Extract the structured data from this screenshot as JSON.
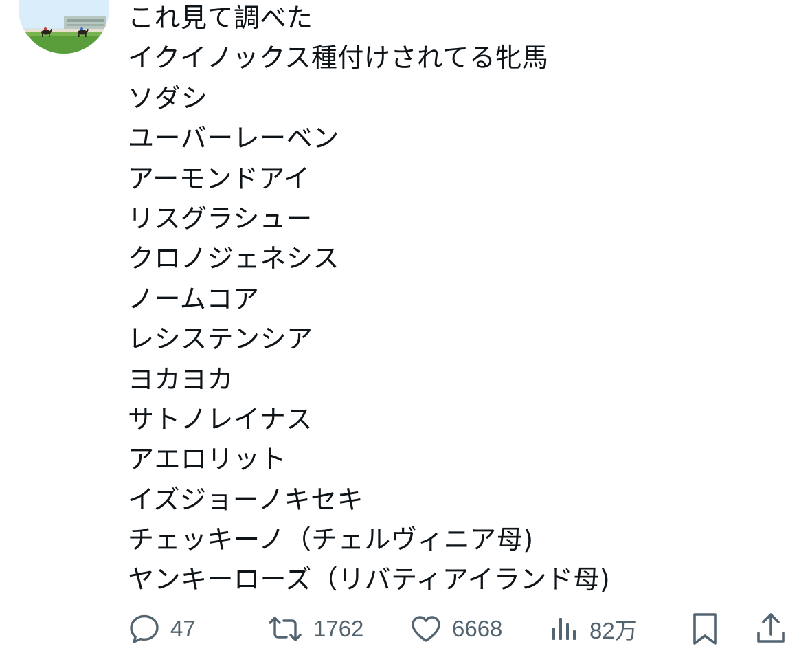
{
  "tweet": {
    "lines": [
      "これ見て調べた",
      "イクイノックス種付けされてる牝馬",
      "ソダシ",
      "ユーバーレーベン",
      "アーモンドアイ",
      "リスグラシュー",
      "クロノジェネシス",
      "ノームコア",
      "レシステンシア",
      "ヨカヨカ",
      "サトノレイナス",
      "アエロリット",
      "イズジョーノキセキ",
      "チェッキーノ（チェルヴィニア母)",
      "ヤンキーローズ（リバティアイランド母)"
    ]
  },
  "actions": {
    "reply": {
      "icon": "reply-icon",
      "count": "47"
    },
    "retweet": {
      "icon": "retweet-icon",
      "count": "1762"
    },
    "like": {
      "icon": "heart-icon",
      "count": "6668"
    },
    "views": {
      "icon": "views-icon",
      "count": "82万"
    },
    "bookmark": {
      "icon": "bookmark-icon"
    },
    "share": {
      "icon": "share-icon"
    }
  },
  "colors": {
    "text": "#0f1419",
    "icon_gray": "#536471",
    "background": "#ffffff"
  }
}
